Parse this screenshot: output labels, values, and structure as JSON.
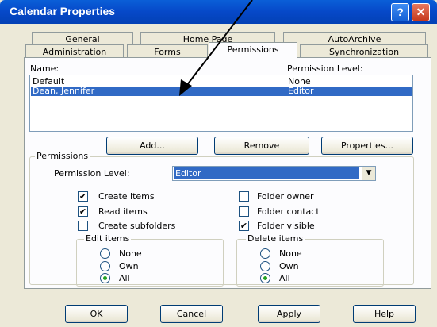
{
  "window": {
    "title": "Calendar Properties",
    "help_glyph": "?",
    "close_glyph": "✕"
  },
  "tabs_row_back": [
    "General",
    "Home Page",
    "AutoArchive"
  ],
  "tabs_row_front": [
    "Administration",
    "Forms",
    "Permissions",
    "Synchronization"
  ],
  "active_tab": "Permissions",
  "list": {
    "name_header": "Name:",
    "level_header": "Permission Level:",
    "rows": [
      {
        "name": "Default",
        "level": "None",
        "selected": false
      },
      {
        "name": "Dean, Jennifer",
        "level": "Editor",
        "selected": true
      }
    ]
  },
  "buttons": {
    "add": "Add...",
    "remove": "Remove",
    "properties": "Properties..."
  },
  "permissions": {
    "group_label": "Permissions",
    "level_label": "Permission Level:",
    "level_value": "Editor",
    "checkboxes": [
      {
        "label": "Create items",
        "checked": true
      },
      {
        "label": "Read items",
        "checked": true
      },
      {
        "label": "Create subfolders",
        "checked": false
      },
      {
        "label": "Folder owner",
        "checked": false
      },
      {
        "label": "Folder contact",
        "checked": false
      },
      {
        "label": "Folder visible",
        "checked": true
      }
    ],
    "edit_items": {
      "label": "Edit items",
      "options": [
        "None",
        "Own",
        "All"
      ],
      "selected": "All"
    },
    "delete_items": {
      "label": "Delete items",
      "options": [
        "None",
        "Own",
        "All"
      ],
      "selected": "All"
    }
  },
  "footer": {
    "ok": "OK",
    "cancel": "Cancel",
    "apply": "Apply",
    "help": "Help"
  },
  "check_glyph": "✔",
  "dropdown_glyph": "▼"
}
